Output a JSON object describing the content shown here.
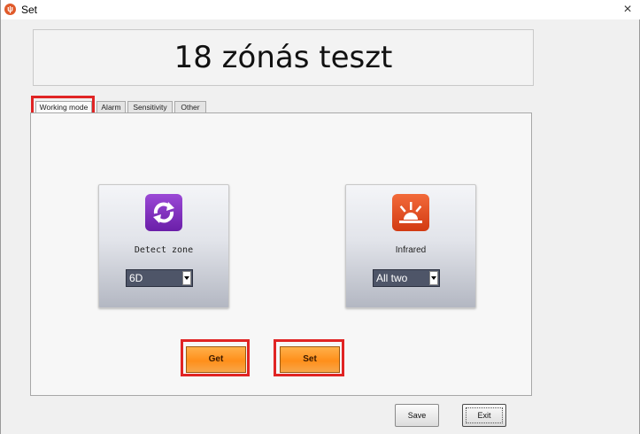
{
  "window": {
    "title": "Set",
    "close_glyph": "×",
    "app_icon_glyph": "ψ"
  },
  "header": {
    "title": "18 zónás teszt"
  },
  "tabs": [
    {
      "label": "Working mode",
      "active": true
    },
    {
      "label": "Alarm",
      "active": false
    },
    {
      "label": "Sensitivity",
      "active": false
    },
    {
      "label": "Other",
      "active": false
    }
  ],
  "cards": {
    "detect_zone": {
      "label": "Detect zone",
      "icon": "refresh-icon",
      "selected": "6D"
    },
    "infrared": {
      "label": "Infrared",
      "icon": "sunrise-icon",
      "selected": "All two"
    }
  },
  "actions": {
    "get_label": "Get",
    "set_label": "Set"
  },
  "footer": {
    "save_label": "Save",
    "exit_label": "Exit"
  },
  "colors": {
    "highlight": "#e02424",
    "button_orange": "#ff8f1a",
    "icon_purple": "#7e2fc0",
    "icon_orange": "#e24a1f",
    "select_bg": "#4e5568"
  }
}
